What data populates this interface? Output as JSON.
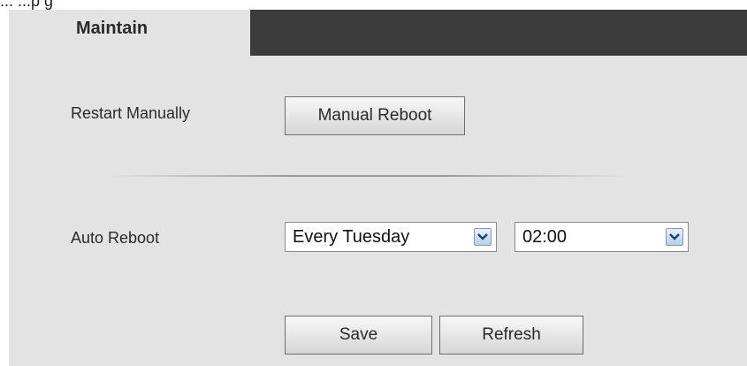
{
  "top_cut_text": "...                                  ...p                                    g",
  "tab": {
    "label": "Maintain"
  },
  "restart": {
    "label": "Restart Manually",
    "button_label": "Manual Reboot"
  },
  "auto_reboot": {
    "label": "Auto Reboot",
    "day_value": "Every Tuesday",
    "time_value": "02:00"
  },
  "actions": {
    "save_label": "Save",
    "refresh_label": "Refresh"
  },
  "colors": {
    "panel_bg": "#e3e3e3",
    "tab_bar_bg": "#3c3c3c"
  },
  "icons": {
    "select_arrow": "chevron-down-icon"
  }
}
